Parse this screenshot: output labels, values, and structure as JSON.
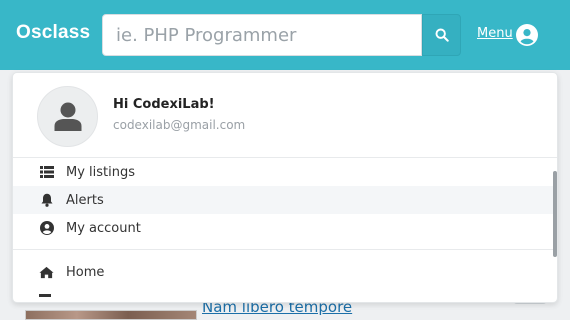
{
  "header": {
    "brand": "Osclass",
    "search_placeholder": "ie. PHP Programmer",
    "menu_label": "Menu"
  },
  "user": {
    "greeting": "Hi CodexiLab!",
    "email": "codexilab@gmail.com"
  },
  "menu": {
    "items": [
      {
        "label": "My listings",
        "icon": "list-icon"
      },
      {
        "label": "Alerts",
        "icon": "bell-icon"
      },
      {
        "label": "My account",
        "icon": "user-circle-icon"
      },
      {
        "label": "Home",
        "icon": "home-icon"
      }
    ]
  },
  "background": {
    "listing_title": "Nam libero tempore"
  },
  "colors": {
    "header_bg": "#38b7c8",
    "link": "#1b6fa8"
  }
}
